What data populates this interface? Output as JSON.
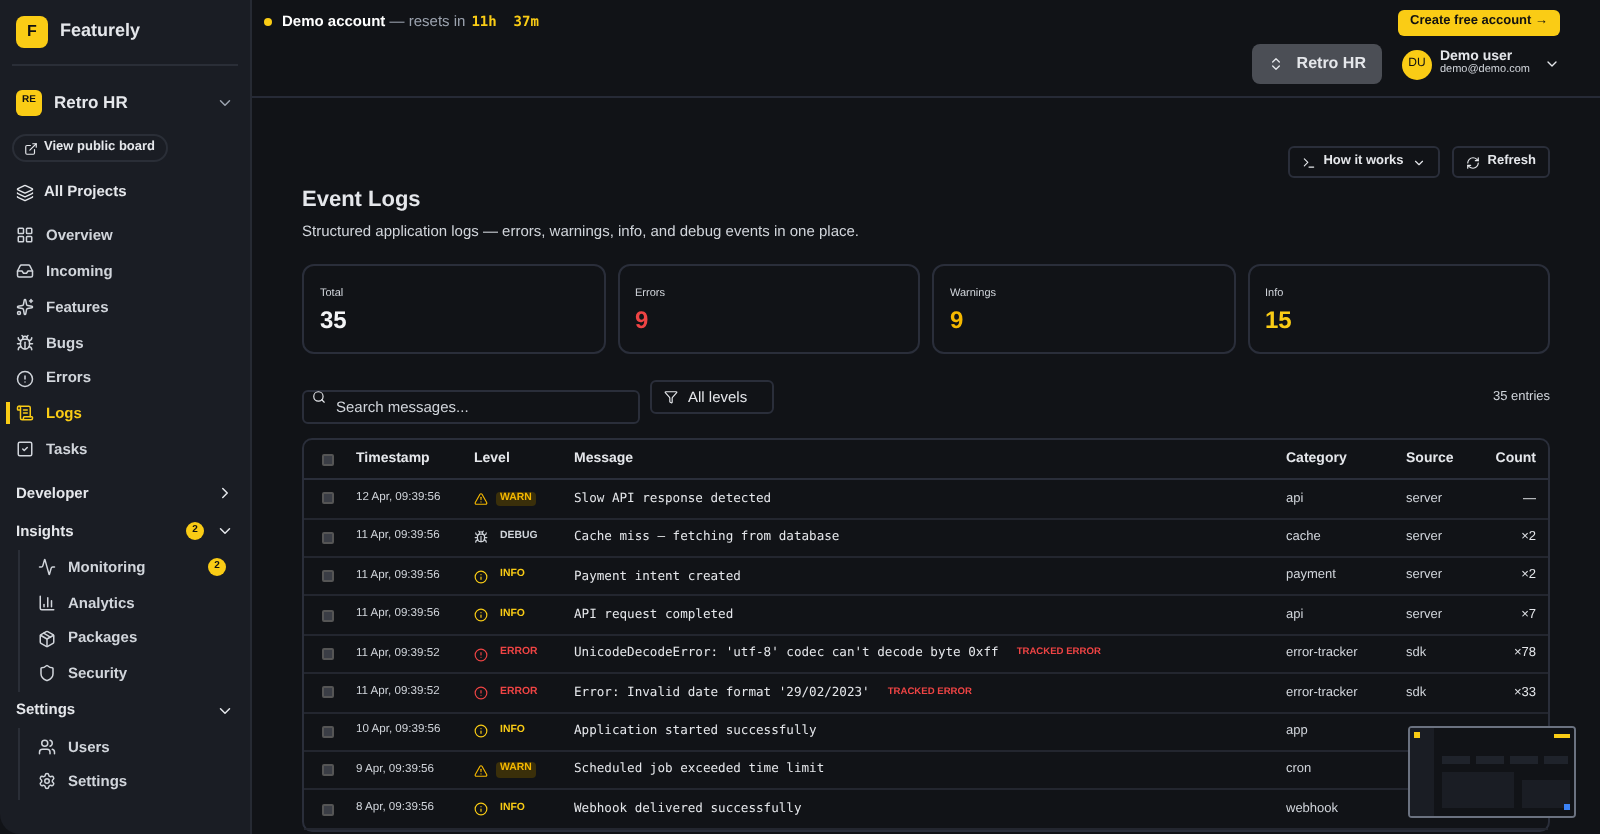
{
  "brand": {
    "initial": "F",
    "name": "Featurely"
  },
  "project": {
    "initials": "RE",
    "name": "Retro HR"
  },
  "public_board": "View public board",
  "all_projects": "All Projects",
  "nav": [
    {
      "label": "Overview",
      "selected": false
    },
    {
      "label": "Incoming",
      "selected": false
    },
    {
      "label": "Features",
      "selected": false
    },
    {
      "label": "Bugs",
      "selected": false
    },
    {
      "label": "Errors",
      "selected": false
    },
    {
      "label": "Logs",
      "selected": true
    },
    {
      "label": "Tasks",
      "selected": false
    }
  ],
  "sections": [
    {
      "label": "Developer",
      "expanded": false
    },
    {
      "label": "Insights",
      "expanded": true,
      "badge": "2",
      "children": [
        {
          "label": "Monitoring",
          "badge": "2"
        },
        {
          "label": "Analytics"
        },
        {
          "label": "Packages"
        },
        {
          "label": "Security"
        }
      ]
    },
    {
      "label": "Settings",
      "expanded": true,
      "children": [
        {
          "label": "Users"
        },
        {
          "label": "Settings"
        }
      ]
    }
  ],
  "banner": {
    "account": "Demo account",
    "text": "— resets in",
    "timer": "11h  37m",
    "cta": "Create free account →"
  },
  "project_switch": "Retro HR",
  "user": {
    "initials": "DU",
    "name": "Demo user",
    "email": "demo@demo.com"
  },
  "actions": [
    "How it works",
    "Refresh"
  ],
  "title": "Event Logs",
  "subtitle": "Structured application logs — errors, warnings, info, and debug events in one place.",
  "stats": [
    {
      "label": "Total",
      "value": "35",
      "color": "#f3f4f6"
    },
    {
      "label": "Errors",
      "value": "9",
      "color": "#ef4444"
    },
    {
      "label": "Warnings",
      "value": "9",
      "color": "#f5b800"
    },
    {
      "label": "Info",
      "value": "15",
      "color": "#facc15"
    }
  ],
  "search": {
    "placeholder": "Search messages..."
  },
  "filter": "All levels",
  "entries": "35 entries",
  "all_checked": false,
  "columns": [
    "Timestamp",
    "Level",
    "Message",
    "Category",
    "Source",
    "Count"
  ],
  "rows": [
    {
      "checked": false,
      "time": "12 Apr, 09:39:56",
      "kind": "warn",
      "level": "WARN",
      "message": "Slow API response detected",
      "category": "api",
      "source": "server",
      "count": "—"
    },
    {
      "checked": false,
      "time": "11 Apr, 09:39:56",
      "kind": "debug",
      "level": "DEBUG",
      "message": "Cache miss — fetching from database",
      "category": "cache",
      "source": "server",
      "count": "×2"
    },
    {
      "checked": false,
      "time": "11 Apr, 09:39:56",
      "kind": "info",
      "level": "INFO",
      "message": "Payment intent created",
      "category": "payment",
      "source": "server",
      "count": "×2"
    },
    {
      "checked": false,
      "time": "11 Apr, 09:39:56",
      "kind": "info",
      "level": "INFO",
      "message": "API request completed",
      "category": "api",
      "source": "server",
      "count": "×7"
    },
    {
      "checked": false,
      "time": "11 Apr, 09:39:52",
      "kind": "error",
      "level": "ERROR",
      "message": "UnicodeDecodeError: 'utf-8' codec can't decode byte 0xff",
      "tag": "TRACKED ERROR",
      "category": "error-tracker",
      "source": "sdk",
      "count": "×78"
    },
    {
      "checked": false,
      "time": "11 Apr, 09:39:52",
      "kind": "error",
      "level": "ERROR",
      "message": "Error: Invalid date format '29/02/2023'",
      "tag": "TRACKED ERROR",
      "category": "error-tracker",
      "source": "sdk",
      "count": "×33"
    },
    {
      "checked": false,
      "time": "10 Apr, 09:39:56",
      "kind": "info",
      "level": "INFO",
      "message": "Application started successfully",
      "category": "app"
    },
    {
      "checked": false,
      "time": "9 Apr, 09:39:56",
      "kind": "warn",
      "level": "WARN",
      "message": "Scheduled job exceeded time limit",
      "category": "cron"
    },
    {
      "checked": false,
      "time": "8 Apr, 09:39:56",
      "kind": "info",
      "level": "INFO",
      "message": "Webhook delivered successfully",
      "category": "webhook"
    }
  ]
}
